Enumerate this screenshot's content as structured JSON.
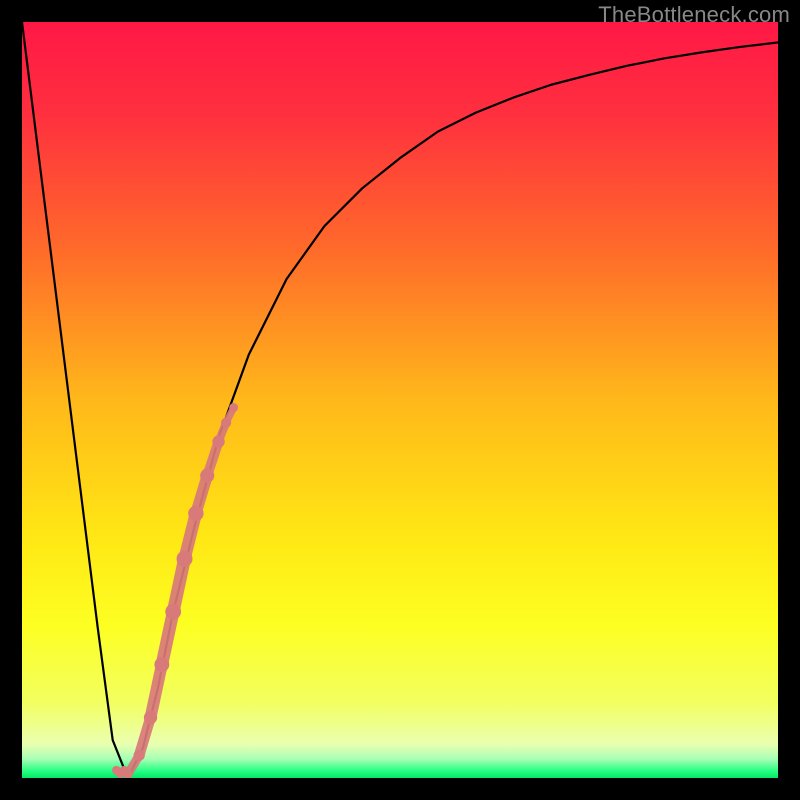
{
  "watermark": "TheBottleneck.com",
  "chart_data": {
    "type": "line",
    "title": "",
    "xlabel": "",
    "ylabel": "",
    "xlim": [
      0,
      100
    ],
    "ylim": [
      0,
      100
    ],
    "grid": false,
    "legend": false,
    "series": [
      {
        "name": "bottleneck-curve",
        "x": [
          0,
          2.5,
          5,
          7.5,
          10,
          12,
          14,
          16,
          18,
          20,
          23,
          26,
          30,
          35,
          40,
          45,
          50,
          55,
          60,
          65,
          70,
          75,
          80,
          85,
          90,
          95,
          100
        ],
        "y": [
          100,
          80,
          60,
          40,
          20,
          5,
          0,
          4,
          12,
          22,
          34,
          45,
          56,
          66,
          73,
          78,
          82,
          85.5,
          88,
          90,
          91.7,
          93,
          94.2,
          95.2,
          96,
          96.7,
          97.3
        ],
        "color": "#000000"
      },
      {
        "name": "highlight-segment",
        "x": [
          14.0,
          15.5,
          17.0,
          18.5,
          20.0,
          21.5,
          23.0,
          24.5,
          26.0,
          27.0,
          28.0
        ],
        "y": [
          0.5,
          3.0,
          8.0,
          15.0,
          22.0,
          29.0,
          35.0,
          40.0,
          44.5,
          47.0,
          49.0
        ],
        "color": "#d97a7a"
      },
      {
        "name": "minimum-marker",
        "type": "scatter",
        "x": [
          13.0
        ],
        "y": [
          0.0
        ],
        "color": "#d97a7a"
      }
    ],
    "background_gradient": {
      "stops": [
        {
          "offset": 0.0,
          "color": "#ff1846"
        },
        {
          "offset": 0.12,
          "color": "#ff2f3f"
        },
        {
          "offset": 0.3,
          "color": "#ff6a2a"
        },
        {
          "offset": 0.5,
          "color": "#ffb81a"
        },
        {
          "offset": 0.68,
          "color": "#ffe714"
        },
        {
          "offset": 0.8,
          "color": "#fdff23"
        },
        {
          "offset": 0.9,
          "color": "#f2ff60"
        },
        {
          "offset": 0.955,
          "color": "#eaffb0"
        },
        {
          "offset": 0.975,
          "color": "#a7ffb5"
        },
        {
          "offset": 0.99,
          "color": "#2bff84"
        },
        {
          "offset": 1.0,
          "color": "#00e869"
        }
      ]
    }
  }
}
